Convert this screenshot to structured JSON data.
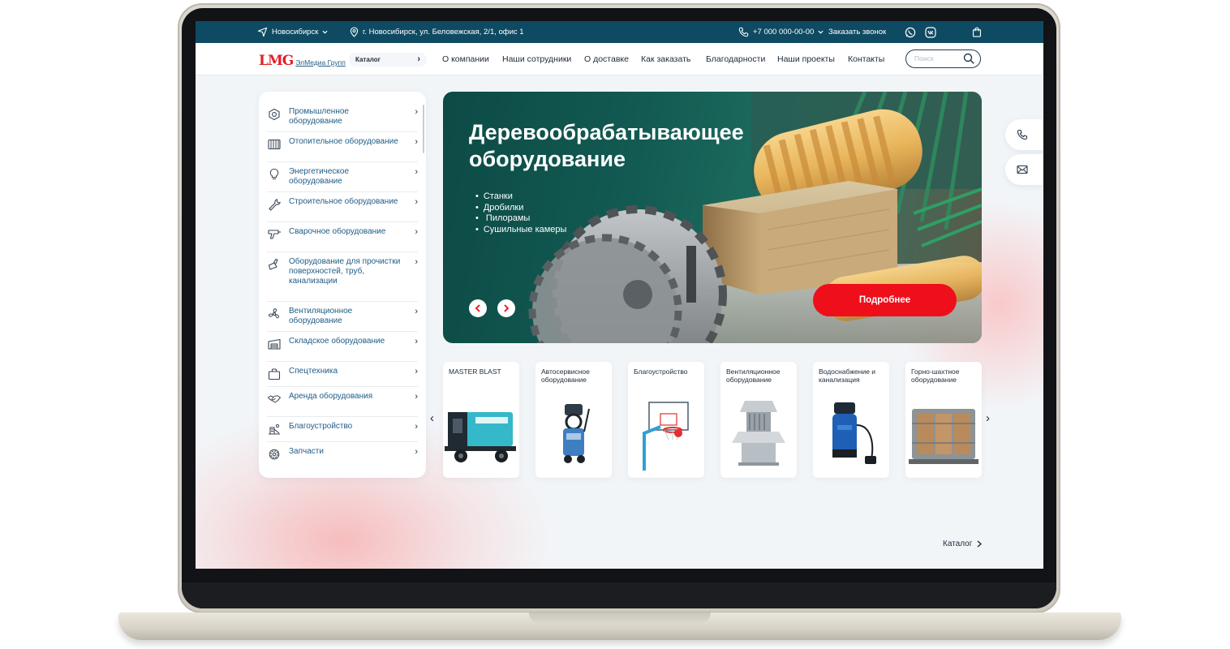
{
  "topbar": {
    "city": "Новосибирск",
    "address": "г. Новосибирск, ул. Беловежская, 2/1, офис 1",
    "phone": "+7 000 000-00-00",
    "callback": "Заказать звонок"
  },
  "logo": {
    "mark": "LMG",
    "text": "ЭлМедиа Групп"
  },
  "nav": {
    "catalog": "Каталог",
    "links": [
      "О компании",
      "Наши сотрудники",
      "О доставке",
      "Как заказать",
      "Благодарности",
      "Наши проекты",
      "Контакты"
    ],
    "search_placeholder": "Поиск"
  },
  "sidebar": {
    "items": [
      {
        "label": "Промышленное оборудование",
        "icon": "gear-icon"
      },
      {
        "label": "Отопительное оборудование",
        "icon": "radiator-icon"
      },
      {
        "label": "Энергетическое оборудование",
        "icon": "lightbulb-icon"
      },
      {
        "label": "Строительное оборудование",
        "icon": "wrench-icon"
      },
      {
        "label": "Сварочное оборудование",
        "icon": "welding-gun-icon"
      },
      {
        "label": "Оборудование для прочистки поверхностей, труб, канализации",
        "icon": "cleaning-icon"
      },
      {
        "label": "Вентиляционное оборудование",
        "icon": "fan-icon"
      },
      {
        "label": "Складское оборудование",
        "icon": "warehouse-icon"
      },
      {
        "label": "Спецтехника",
        "icon": "bag-icon"
      },
      {
        "label": "Аренда оборудования",
        "icon": "handshake-icon"
      },
      {
        "label": "Благоустройство",
        "icon": "playground-icon"
      },
      {
        "label": "Запчасти",
        "icon": "cog-icon"
      }
    ]
  },
  "hero": {
    "title": "Деревообрабатывающее оборудование",
    "bullets": [
      "Станки",
      "Дробилки",
      " Пилорамы",
      "Сушильные камеры"
    ],
    "button": "Подробнее",
    "colors": {
      "button": "#ef0f1a",
      "background": "#125a52"
    }
  },
  "cards": [
    {
      "label": "MASTER BLAST",
      "image": "compressor-image"
    },
    {
      "label": "Автосервисное оборудование",
      "image": "pressure-washer-image"
    },
    {
      "label": "Благоустройство",
      "image": "basketball-hoop-image"
    },
    {
      "label": "Вентиляционное оборудование",
      "image": "roof-fan-image"
    },
    {
      "label": "Водоснабжение и канализация",
      "image": "submersible-pump-image"
    },
    {
      "label": "Горно-шахтное оборудование",
      "image": "transformer-image"
    }
  ],
  "catalog_link": "Каталог",
  "colors": {
    "topbar": "#0f4a63",
    "accent": "#ef0f1a",
    "link": "#1f5c86"
  }
}
